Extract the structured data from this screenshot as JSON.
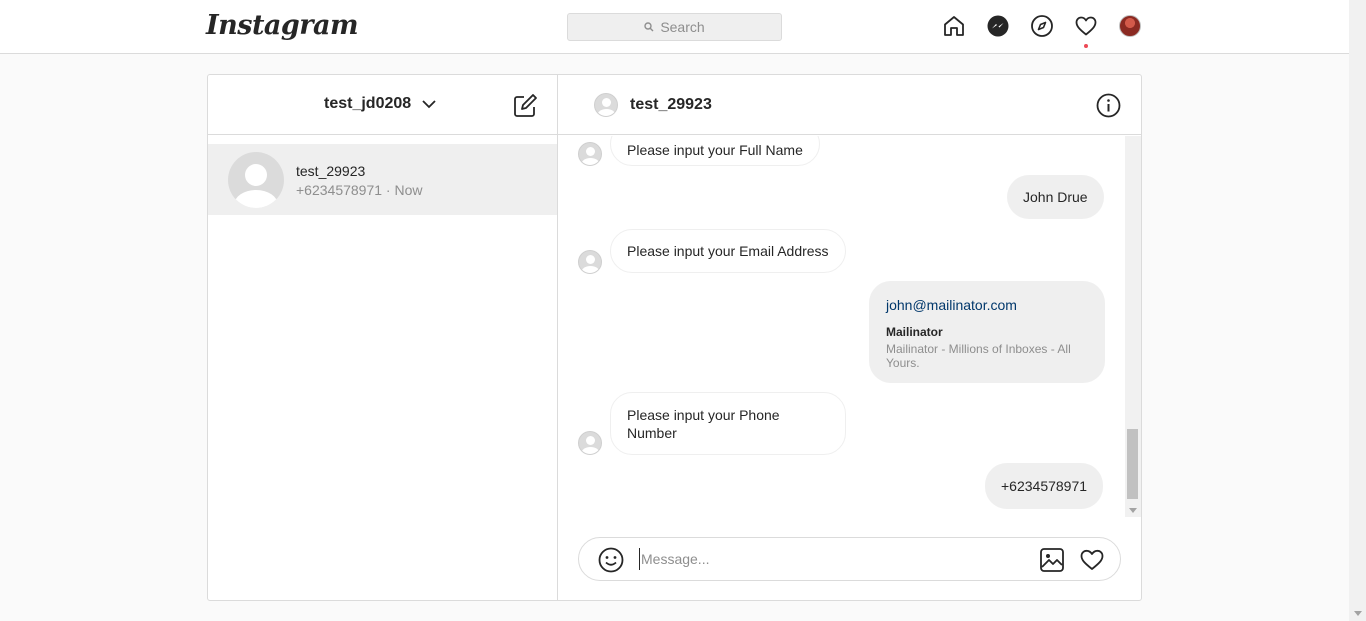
{
  "nav": {
    "logo": "Instagram",
    "search_placeholder": "Search",
    "icons": [
      "home-icon",
      "messenger-icon",
      "explore-icon",
      "heart-icon",
      "profile-avatar"
    ],
    "notification_color": "#ed4956"
  },
  "inbox": {
    "account_name": "test_jd0208",
    "threads": [
      {
        "name": "test_29923",
        "subtitle": "+6234578971 · Now"
      }
    ]
  },
  "chat": {
    "contact_name": "test_29923",
    "messages": [
      {
        "from": "them",
        "text": "Please input your Full Name"
      },
      {
        "from": "me",
        "text": "John Drue"
      },
      {
        "from": "them",
        "text": "Please input your Email Address"
      },
      {
        "from": "me",
        "type": "link",
        "text": "john@mailinator.com",
        "preview_title": "Mailinator",
        "preview_desc": "Mailinator - Millions of Inboxes - All Yours."
      },
      {
        "from": "them",
        "text": "Please input your Phone Number"
      },
      {
        "from": "me",
        "text": "+6234578971"
      }
    ],
    "composer_placeholder": "Message..."
  }
}
